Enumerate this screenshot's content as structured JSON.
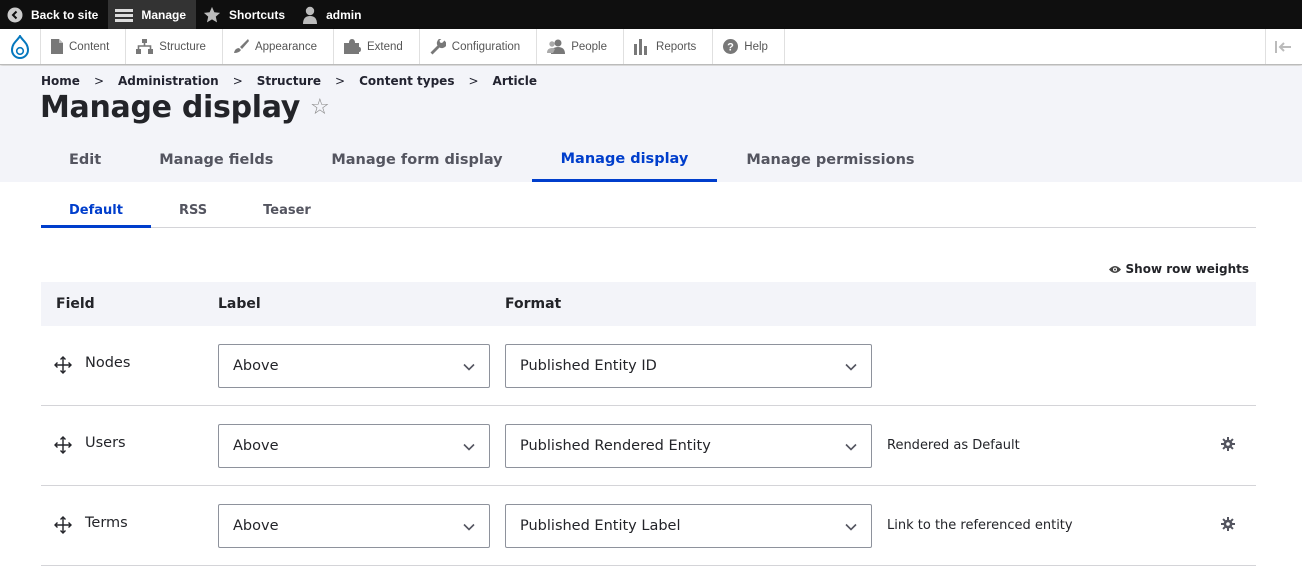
{
  "toolbar": {
    "back_label": "Back to site",
    "manage_label": "Manage",
    "shortcuts_label": "Shortcuts",
    "user_label": "admin"
  },
  "admin_menu": {
    "items": [
      {
        "label": "Content",
        "icon": "file-icon"
      },
      {
        "label": "Structure",
        "icon": "sitemap-icon"
      },
      {
        "label": "Appearance",
        "icon": "paintbrush-icon"
      },
      {
        "label": "Extend",
        "icon": "puzzle-icon"
      },
      {
        "label": "Configuration",
        "icon": "wrench-icon"
      },
      {
        "label": "People",
        "icon": "people-icon"
      },
      {
        "label": "Reports",
        "icon": "bar-chart-icon"
      },
      {
        "label": "Help",
        "icon": "help-icon"
      }
    ]
  },
  "breadcrumb": [
    "Home",
    "Administration",
    "Structure",
    "Content types",
    "Article"
  ],
  "breadcrumb_separator": ">",
  "page_title": "Manage display",
  "star_glyph": "☆",
  "tabs": [
    "Edit",
    "Manage fields",
    "Manage form display",
    "Manage display",
    "Manage permissions"
  ],
  "active_tab": "Manage display",
  "subtabs": [
    "Default",
    "RSS",
    "Teaser"
  ],
  "active_subtab": "Default",
  "row_weights_label": "Show row weights",
  "table": {
    "headers": {
      "field": "Field",
      "label": "Label",
      "format": "Format"
    },
    "rows": [
      {
        "field": "Nodes",
        "label_value": "Above",
        "format_value": "Published Entity ID",
        "summary": "",
        "has_settings": false
      },
      {
        "field": "Users",
        "label_value": "Above",
        "format_value": "Published Rendered Entity",
        "summary": "Rendered as Default",
        "has_settings": true
      },
      {
        "field": "Terms",
        "label_value": "Above",
        "format_value": "Published Entity Label",
        "summary": "Link to the referenced entity",
        "has_settings": true
      }
    ]
  },
  "colors": {
    "toolbar_bg": "#0f0f0f",
    "accent": "#003ecc",
    "header_bg": "#f3f4f9",
    "drupal_blue": "#0678be"
  }
}
